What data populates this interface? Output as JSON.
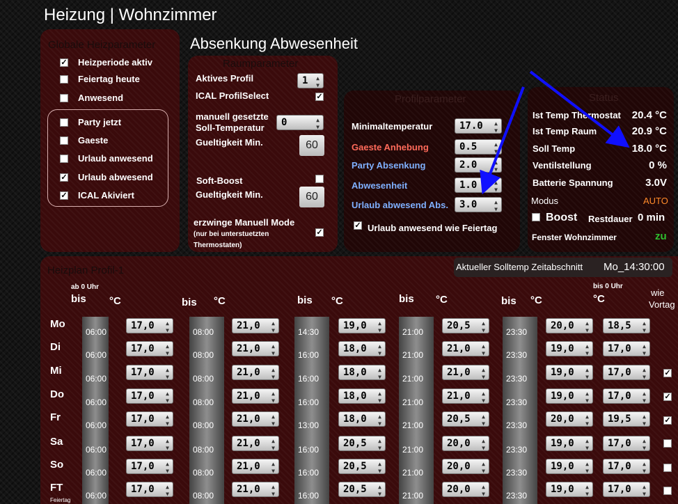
{
  "title": "Heizung | Wohnzimmer",
  "global": {
    "title": "Globale Heizparameter",
    "items": [
      {
        "label": "Heizperiode aktiv",
        "checked": true
      },
      {
        "label": "Feiertag heute",
        "checked": false
      },
      {
        "label": "Anwesend",
        "checked": false
      },
      {
        "label": "Party jetzt",
        "checked": false
      },
      {
        "label": "Gaeste",
        "checked": false
      },
      {
        "label": "Urlaub anwesend",
        "checked": false
      },
      {
        "label": "Urlaub abwesend",
        "checked": true
      },
      {
        "label": "ICAL Akiviert",
        "checked": true
      }
    ]
  },
  "section_title": "Absenkung Abwesenheit",
  "room": {
    "title": "Raumparameter",
    "active_profile_label": "Aktives Profil",
    "active_profile_value": "1",
    "ical_label": "ICAL ProfilSelect",
    "manual_label_1": "manuell gesetzte",
    "manual_label_2": "Soll-Temperatur",
    "manual_value": "0",
    "valid_label": "Gueltigkeit Min.",
    "valid_value": "60",
    "softboost_label": "Soft-Boost",
    "valid2_label": "Gueltigkeit Min.",
    "valid2_value": "60",
    "force_label": "erzwinge Manuell Mode",
    "force_note_1": "(nur bei unterstuetzten",
    "force_note_2": "Thermostaten)"
  },
  "profile": {
    "title": "Profilparameter",
    "rows": [
      {
        "label": "Minimaltemperatur",
        "value": "17.0",
        "color": "#ffffff"
      },
      {
        "label": "Gaeste Anhebung",
        "value": "0.5",
        "color": "#ff6a5a"
      },
      {
        "label": "Party Absenkung",
        "value": "2.0",
        "color": "#7fb0ff"
      },
      {
        "label": "Abwesenheit",
        "value": "1.0",
        "color": "#7fb0ff"
      },
      {
        "label": "Urlaub abwesend Abs.",
        "value": "3.0",
        "color": "#7fb0ff"
      }
    ],
    "holiday_label": "Urlaub anwesend wie Feiertag"
  },
  "status": {
    "title": "Status",
    "rows": [
      {
        "label": "Ist Temp Thermostat",
        "value": "20.4 °C"
      },
      {
        "label": "Ist Temp Raum",
        "value": "20.9 °C"
      },
      {
        "label": "Soll Temp",
        "value": "18.0 °C"
      },
      {
        "label": "Ventilstellung",
        "value": "0 %"
      },
      {
        "label": "Batterie Spannung",
        "value": "3.0V"
      }
    ],
    "modus_label": "Modus",
    "modus_value": "AUTO",
    "boost_label": "Boost",
    "rest_label": "Restdauer",
    "rest_value": "0 min",
    "window_label": "Fenster Wohnzimmer",
    "window_value": "zu"
  },
  "plan": {
    "title": "Heizplan Profil-1",
    "current_label": "Aktueller Solltemp Zeitabschnitt",
    "current_value": "Mo_14:30:00",
    "header_ab": "ab 0 Uhr",
    "header_bis": "bis",
    "header_deg": "°C",
    "header_bis0": "bis 0 Uhr",
    "header_wie": "wie",
    "header_vortag": "Vortag",
    "days": [
      {
        "day": "Mo",
        "t1": "06:00",
        "v1": "17,0",
        "t2": "08:00",
        "v2": "21,0",
        "t3": "14:30",
        "v3": "19,0",
        "t4": "21:00",
        "v4": "20,5",
        "t5": "23:30",
        "v5": "20,0",
        "v6": "18,5",
        "wie": null
      },
      {
        "day": "Di",
        "t1": "06:00",
        "v1": "17,0",
        "t2": "08:00",
        "v2": "21,0",
        "t3": "16:00",
        "v3": "18,0",
        "t4": "21:00",
        "v4": "21,0",
        "t5": "23:30",
        "v5": "19,0",
        "v6": "17,0",
        "wie": true
      },
      {
        "day": "Mi",
        "t1": "06:00",
        "v1": "17,0",
        "t2": "08:00",
        "v2": "21,0",
        "t3": "16:00",
        "v3": "18,0",
        "t4": "21:00",
        "v4": "21,0",
        "t5": "23:30",
        "v5": "19,0",
        "v6": "17,0",
        "wie": true
      },
      {
        "day": "Do",
        "t1": "06:00",
        "v1": "17,0",
        "t2": "08:00",
        "v2": "21,0",
        "t3": "16:00",
        "v3": "18,0",
        "t4": "21:00",
        "v4": "21,0",
        "t5": "23:30",
        "v5": "19,0",
        "v6": "17,0",
        "wie": true
      },
      {
        "day": "Fr",
        "t1": "06:00",
        "v1": "17,0",
        "t2": "08:00",
        "v2": "21,0",
        "t3": "13:00",
        "v3": "18,0",
        "t4": "21:00",
        "v4": "20,5",
        "t5": "23:30",
        "v5": "20,0",
        "v6": "19,5",
        "wie": false
      },
      {
        "day": "Sa",
        "t1": "06:00",
        "v1": "17,0",
        "t2": "08:00",
        "v2": "21,0",
        "t3": "16:00",
        "v3": "20,5",
        "t4": "21:00",
        "v4": "20,0",
        "t5": "23:30",
        "v5": "19,0",
        "v6": "17,0",
        "wie": false
      },
      {
        "day": "So",
        "t1": "06:00",
        "v1": "17,0",
        "t2": "08:00",
        "v2": "21,0",
        "t3": "16:00",
        "v3": "20,5",
        "t4": "21:00",
        "v4": "20,0",
        "t5": "23:30",
        "v5": "19,0",
        "v6": "17,0",
        "wie": false
      },
      {
        "day": "FT",
        "t1": "06:00",
        "v1": "17,0",
        "t2": "08:00",
        "v2": "21,0",
        "t3": "16:00",
        "v3": "20,5",
        "t4": "21:00",
        "v4": "20,0",
        "t5": "23:30",
        "v5": "19,0",
        "v6": "17,0",
        "wie": false,
        "sub": "Feiertag"
      }
    ]
  }
}
